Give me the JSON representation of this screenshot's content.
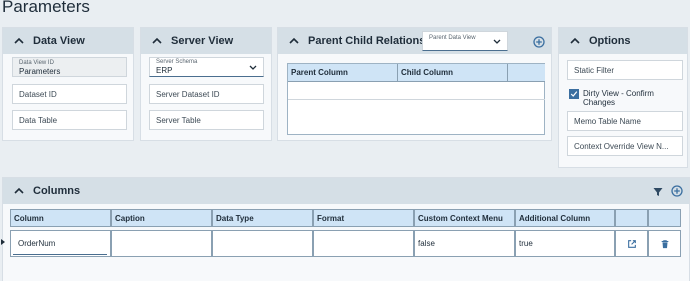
{
  "page": {
    "title": "Parameters"
  },
  "data_view": {
    "title": "Data View",
    "id_label": "Data View ID",
    "id_value": "Parameters",
    "dataset_placeholder": "Dataset ID",
    "table_placeholder": "Data Table"
  },
  "server_view": {
    "title": "Server View",
    "schema_label": "Server Schema",
    "schema_value": "ERP",
    "dataset_placeholder": "Server Dataset ID",
    "table_placeholder": "Server Table"
  },
  "relationships": {
    "title": "Parent Child Relationships",
    "select_label": "Parent Data View",
    "headers": [
      "Parent Column",
      "Child Column",
      ""
    ]
  },
  "options": {
    "title": "Options",
    "static_filter_placeholder": "Static Filter",
    "dirty_view_label": "Dirty View - Confirm Changes",
    "memo_table_placeholder": "Memo Table Name",
    "context_override_placeholder": "Context Override View N..."
  },
  "columns": {
    "title": "Columns",
    "headers": [
      "Column",
      "Caption",
      "Data Type",
      "Format",
      "Custom Context Menu",
      "Additional Column",
      "",
      ""
    ],
    "rows": [
      {
        "column": "OrderNum",
        "caption": "",
        "data_type": "",
        "format": "",
        "custom_context_menu": "false",
        "additional_column": "true"
      }
    ]
  },
  "colors": {
    "accent": "#3b6fa0",
    "header_bg": "#d5dfe6",
    "grid_header_bg": "#cfe4f6"
  },
  "icons": [
    "chevron-up-icon",
    "chevron-down-icon",
    "add-circle-icon",
    "filter-icon",
    "external-link-icon",
    "trash-icon",
    "row-pointer-icon",
    "checkbox-checked-icon"
  ]
}
